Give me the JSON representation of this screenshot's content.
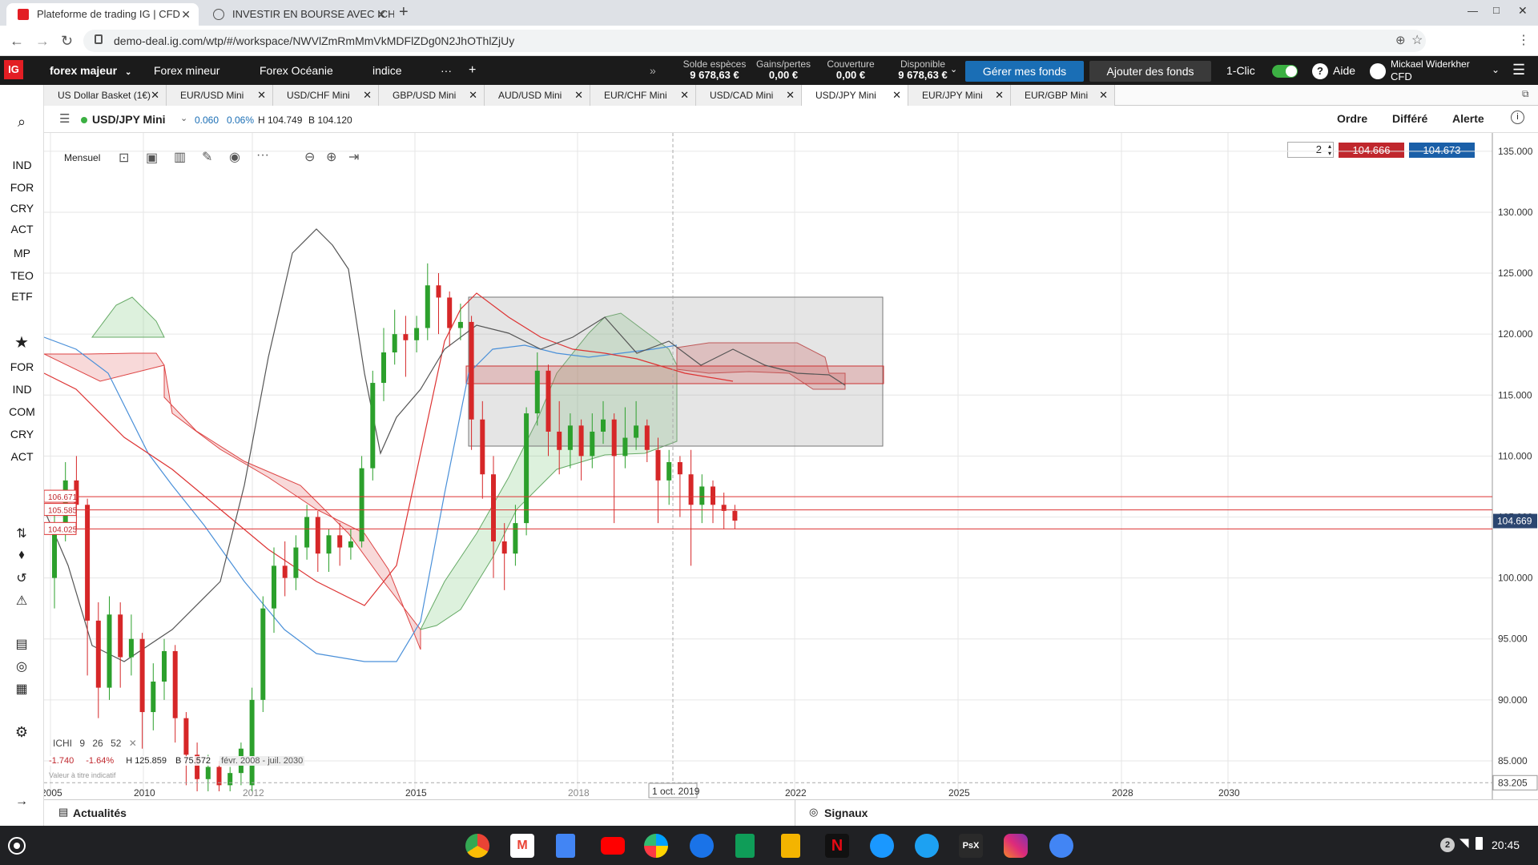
{
  "browser": {
    "tabs": [
      {
        "title": "Plateforme de trading IG | CFD",
        "active": true
      },
      {
        "title": "INVESTIR EN BOURSE AVEC ICH",
        "active": false
      }
    ],
    "url": "demo-deal.ig.com/wtp/#/workspace/NWVlZmRmMmVkMDFlZDg0N2JhOThlZjUy",
    "window_controls": [
      "—",
      "□",
      "✕"
    ]
  },
  "ig": {
    "logo": "IG",
    "nav": [
      "forex majeur",
      "Forex mineur",
      "Forex Océanie",
      "indice"
    ],
    "account": [
      {
        "label": "Solde espèces",
        "value": "9 678,63 €"
      },
      {
        "label": "Gains/pertes",
        "value": "0,00 €"
      },
      {
        "label": "Couverture",
        "value": "0,00 €"
      },
      {
        "label": "Disponible",
        "value": "9 678,63 €"
      }
    ],
    "manage_funds": "Gérer mes fonds",
    "add_funds": "Ajouter des fonds",
    "one_click": "1-Clic",
    "help": "Aide",
    "user_name": "Mickael Widerkher",
    "user_account": "CFD",
    "colors": {
      "manage_btn": "#1a6eb5",
      "buy": "#1a5fa8",
      "sell": "#c0272d",
      "up": "#2ca02c",
      "down": "#d62728"
    }
  },
  "market_tabs": [
    "US Dollar Basket (1€)",
    "EUR/USD Mini",
    "USD/CHF Mini",
    "GBP/USD Mini",
    "AUD/USD Mini",
    "EUR/CHF Mini",
    "USD/CAD Mini",
    "USD/JPY Mini",
    "EUR/JPY Mini",
    "EUR/GBP Mini"
  ],
  "active_market": "USD/JPY Mini",
  "sidebar": {
    "group1": [
      "IND",
      "FOR",
      "CRY",
      "ACT",
      "MP",
      "TEO",
      "ETF"
    ],
    "group2": [
      "FOR",
      "IND",
      "COM",
      "CRY",
      "ACT"
    ]
  },
  "chart_header": {
    "instrument": "USD/JPY Mini",
    "change": "0.060",
    "change_pct": "0.06%",
    "high": "H 104.749",
    "low": "B 104.120",
    "order": "Ordre",
    "deferred": "Différé",
    "alert": "Alerte",
    "timeframe": "Mensuel",
    "quantity": "2",
    "sell_price": "104.666",
    "buy_price": "104.673"
  },
  "indicator": {
    "name": "ICHI",
    "params": [
      "9",
      "26",
      "52"
    ],
    "change": "-1.740",
    "change_pct": "-1.64%",
    "high": "H 125.859",
    "low": "B 75.572",
    "range": "févr. 2008 - juil. 2030",
    "note": "Valeur à titre indicatif"
  },
  "chart_data": {
    "type": "candlestick",
    "title": "USD/JPY Mini",
    "y_ticks": [
      "135.000",
      "130.000",
      "125.000",
      "120.000",
      "115.000",
      "110.000",
      "105.000",
      "100.000",
      "95.000",
      "90.000",
      "85.000"
    ],
    "x_ticks": [
      "2005",
      "2010",
      "2012",
      "2015",
      "2018",
      "2022",
      "2025",
      "2028",
      "2030"
    ],
    "ylim": [
      82.5,
      136.5
    ],
    "current_price": "104.669",
    "crosshair_price": "83.205",
    "crosshair_date": "1 oct. 2019",
    "levels": [
      {
        "label": "106.671",
        "value": 106.671
      },
      {
        "label": "105.585",
        "value": 105.585
      },
      {
        "label": "104.025",
        "value": 104.025
      }
    ],
    "candles": [
      {
        "x": 0,
        "o": 100.0,
        "c": 104.5,
        "h": 106.0,
        "l": 97.5
      },
      {
        "x": 1,
        "o": 104.5,
        "c": 108.0,
        "h": 109.5,
        "l": 103.0
      },
      {
        "x": 2,
        "o": 108.0,
        "c": 106.0,
        "h": 110.0,
        "l": 104.0
      },
      {
        "x": 3,
        "o": 106.0,
        "c": 96.5,
        "h": 106.5,
        "l": 92.0
      },
      {
        "x": 4,
        "o": 96.5,
        "c": 91.0,
        "h": 98.0,
        "l": 88.5
      },
      {
        "x": 5,
        "o": 91.0,
        "c": 97.0,
        "h": 98.5,
        "l": 90.0
      },
      {
        "x": 6,
        "o": 97.0,
        "c": 93.5,
        "h": 98.0,
        "l": 91.0
      },
      {
        "x": 7,
        "o": 93.5,
        "c": 95.0,
        "h": 97.0,
        "l": 92.0
      },
      {
        "x": 8,
        "o": 95.0,
        "c": 89.0,
        "h": 95.5,
        "l": 86.0
      },
      {
        "x": 9,
        "o": 89.0,
        "c": 91.5,
        "h": 93.0,
        "l": 87.5
      },
      {
        "x": 10,
        "o": 91.5,
        "c": 94.0,
        "h": 95.0,
        "l": 90.0
      },
      {
        "x": 11,
        "o": 94.0,
        "c": 88.5,
        "h": 94.5,
        "l": 86.5
      },
      {
        "x": 12,
        "o": 88.5,
        "c": 85.5,
        "h": 89.0,
        "l": 83.0
      },
      {
        "x": 13,
        "o": 85.5,
        "c": 83.5,
        "h": 86.5,
        "l": 82.5
      },
      {
        "x": 14,
        "o": 83.5,
        "c": 84.5,
        "h": 85.5,
        "l": 82.5
      },
      {
        "x": 15,
        "o": 84.5,
        "c": 83.0,
        "h": 85.0,
        "l": 82.5
      },
      {
        "x": 16,
        "o": 83.0,
        "c": 84.0,
        "h": 84.5,
        "l": 82.5
      },
      {
        "x": 17,
        "o": 84.0,
        "c": 86.0,
        "h": 86.5,
        "l": 83.0
      },
      {
        "x": 18,
        "o": 83.0,
        "c": 90.0,
        "h": 91.0,
        "l": 82.5
      },
      {
        "x": 19,
        "o": 90.0,
        "c": 97.5,
        "h": 98.5,
        "l": 89.0
      },
      {
        "x": 20,
        "o": 97.5,
        "c": 101.0,
        "h": 102.5,
        "l": 95.5
      },
      {
        "x": 21,
        "o": 101.0,
        "c": 100.0,
        "h": 103.0,
        "l": 98.5
      },
      {
        "x": 22,
        "o": 100.0,
        "c": 102.5,
        "h": 103.5,
        "l": 99.0
      },
      {
        "x": 23,
        "o": 102.5,
        "c": 105.0,
        "h": 106.0,
        "l": 101.5
      },
      {
        "x": 24,
        "o": 105.0,
        "c": 102.0,
        "h": 105.5,
        "l": 100.5
      },
      {
        "x": 25,
        "o": 102.0,
        "c": 103.5,
        "h": 104.0,
        "l": 100.5
      },
      {
        "x": 26,
        "o": 103.5,
        "c": 102.5,
        "h": 104.5,
        "l": 101.0
      },
      {
        "x": 27,
        "o": 102.5,
        "c": 103.0,
        "h": 104.0,
        "l": 101.5
      },
      {
        "x": 28,
        "o": 103.0,
        "c": 109.0,
        "h": 110.0,
        "l": 102.5
      },
      {
        "x": 29,
        "o": 109.0,
        "c": 116.0,
        "h": 117.0,
        "l": 108.0
      },
      {
        "x": 30,
        "o": 116.0,
        "c": 118.5,
        "h": 120.5,
        "l": 114.5
      },
      {
        "x": 31,
        "o": 118.5,
        "c": 120.0,
        "h": 122.0,
        "l": 117.5
      },
      {
        "x": 32,
        "o": 120.0,
        "c": 119.5,
        "h": 121.5,
        "l": 116.5
      },
      {
        "x": 33,
        "o": 119.5,
        "c": 120.5,
        "h": 121.5,
        "l": 118.5
      },
      {
        "x": 34,
        "o": 120.5,
        "c": 124.0,
        "h": 125.8,
        "l": 119.5
      },
      {
        "x": 35,
        "o": 124.0,
        "c": 123.0,
        "h": 125.0,
        "l": 120.0
      },
      {
        "x": 36,
        "o": 123.0,
        "c": 120.5,
        "h": 123.5,
        "l": 119.0
      },
      {
        "x": 37,
        "o": 120.5,
        "c": 121.0,
        "h": 122.5,
        "l": 119.5
      },
      {
        "x": 38,
        "o": 121.0,
        "c": 113.0,
        "h": 121.5,
        "l": 110.5
      },
      {
        "x": 39,
        "o": 113.0,
        "c": 108.5,
        "h": 114.5,
        "l": 106.5
      },
      {
        "x": 40,
        "o": 108.5,
        "c": 103.0,
        "h": 110.0,
        "l": 100.0
      },
      {
        "x": 41,
        "o": 103.0,
        "c": 102.0,
        "h": 104.5,
        "l": 99.0
      },
      {
        "x": 42,
        "o": 102.0,
        "c": 104.5,
        "h": 106.0,
        "l": 101.0
      },
      {
        "x": 43,
        "o": 104.5,
        "c": 113.5,
        "h": 114.0,
        "l": 103.5
      },
      {
        "x": 44,
        "o": 113.5,
        "c": 117.0,
        "h": 118.5,
        "l": 112.5
      },
      {
        "x": 45,
        "o": 117.0,
        "c": 112.0,
        "h": 117.5,
        "l": 110.0
      },
      {
        "x": 46,
        "o": 112.0,
        "c": 110.5,
        "h": 114.5,
        "l": 108.5
      },
      {
        "x": 47,
        "o": 110.5,
        "c": 112.5,
        "h": 113.5,
        "l": 109.0
      },
      {
        "x": 48,
        "o": 112.5,
        "c": 110.0,
        "h": 113.0,
        "l": 108.0
      },
      {
        "x": 49,
        "o": 110.0,
        "c": 112.0,
        "h": 113.5,
        "l": 109.0
      },
      {
        "x": 50,
        "o": 112.0,
        "c": 113.0,
        "h": 114.5,
        "l": 111.0
      },
      {
        "x": 51,
        "o": 113.0,
        "c": 110.0,
        "h": 113.5,
        "l": 104.5
      },
      {
        "x": 52,
        "o": 110.0,
        "c": 111.5,
        "h": 114.0,
        "l": 109.0
      },
      {
        "x": 53,
        "o": 111.5,
        "c": 112.5,
        "h": 114.5,
        "l": 110.5
      },
      {
        "x": 54,
        "o": 112.5,
        "c": 110.5,
        "h": 113.0,
        "l": 109.5
      },
      {
        "x": 55,
        "o": 110.5,
        "c": 108.0,
        "h": 111.5,
        "l": 104.5
      },
      {
        "x": 56,
        "o": 108.0,
        "c": 109.5,
        "h": 110.5,
        "l": 106.0
      },
      {
        "x": 57,
        "o": 109.5,
        "c": 108.5,
        "h": 110.0,
        "l": 105.0
      },
      {
        "x": 58,
        "o": 108.5,
        "c": 106.0,
        "h": 110.5,
        "l": 101.0
      },
      {
        "x": 59,
        "o": 106.0,
        "c": 107.5,
        "h": 108.5,
        "l": 104.5
      },
      {
        "x": 60,
        "o": 107.5,
        "c": 106.0,
        "h": 108.0,
        "l": 104.5
      },
      {
        "x": 61,
        "o": 106.0,
        "c": 105.5,
        "h": 107.0,
        "l": 104.0
      },
      {
        "x": 62,
        "o": 105.5,
        "c": 104.7,
        "h": 106.0,
        "l": 104.0
      }
    ]
  },
  "bottom": {
    "news": "Actualités",
    "signals": "Signaux"
  },
  "taskbar": {
    "badge": "2",
    "time": "20:45"
  }
}
